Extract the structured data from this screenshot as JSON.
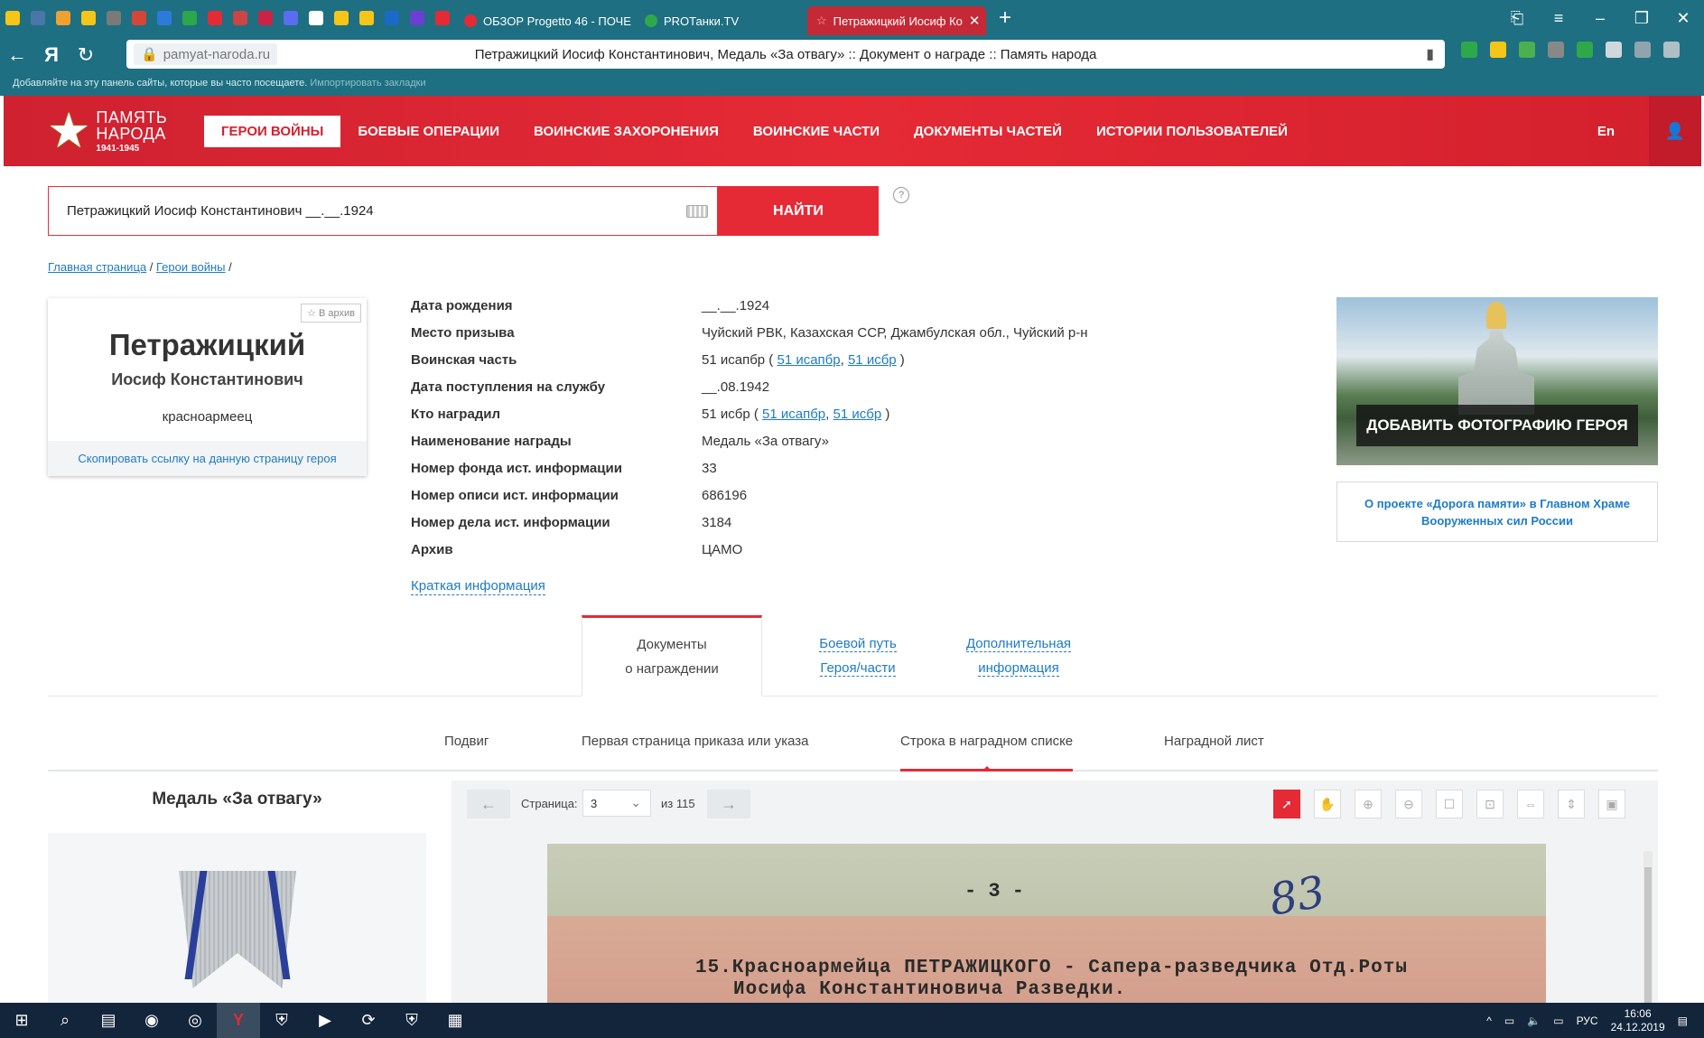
{
  "browser": {
    "favicon_colors": [
      "#f5c518",
      "#4a76a8",
      "#f0a030",
      "#f5c518",
      "#7a7a7a",
      "#d44638",
      "#2d7bd8",
      "#2aa84a",
      "#e52a35",
      "#c44",
      "#c24",
      "#5b6cf0",
      "#ffffff",
      "#f5c518",
      "#f5c518",
      "#1b6ac9",
      "#6b3fd4",
      "#e52a35"
    ],
    "tabs": [
      {
        "label": "ОБЗОР Progetto 46 - ПОЧЕ",
        "color": "#e52a35"
      },
      {
        "label": "PROТанки.TV",
        "color": "#2fa84a"
      },
      {
        "label": "Петражицкий Иосиф Ко",
        "color": "#e52a35",
        "active": true
      }
    ],
    "new_tab": "+",
    "domain": "pamyat-naroda.ru",
    "page_title": "Петражицкий Иосиф Константинович, Медаль «За отвагу» :: Документ о награде :: Память народа",
    "bookmarks_hint": "Добавляйте на эту панель сайты, которые вы часто посещаете.",
    "bookmarks_import": "Импортировать закладки",
    "extension_colors": [
      "#2fa84a",
      "#f5c518",
      "#4caf50",
      "#888888",
      "#2fa84a",
      "#cfd8dc",
      "#90a4ae",
      "#b0bec5"
    ]
  },
  "site": {
    "logo_line1": "ПАМЯТЬ",
    "logo_line2": "НАРОДА",
    "logo_years": "1941-1945",
    "menu": [
      "ГЕРОИ ВОЙНЫ",
      "БОЕВЫЕ ОПЕРАЦИИ",
      "ВОИНСКИЕ ЗАХОРОНЕНИЯ",
      "ВОИНСКИЕ ЧАСТИ",
      "ДОКУМЕНТЫ ЧАСТЕЙ",
      "ИСТОРИИ ПОЛЬЗОВАТЕЛЕЙ"
    ],
    "lang": "En"
  },
  "search": {
    "value": "Петражицкий Иосиф Константинович __.__.1924",
    "button": "НАЙТИ",
    "help": "?"
  },
  "breadcrumbs": {
    "home": "Главная страница",
    "section": "Герои войны",
    "sep": "/"
  },
  "hero": {
    "archive_btn": "В архив",
    "surname": "Петражицкий",
    "given": "Иосиф Константинович",
    "rank": "красноармеец",
    "copy_link": "Скопировать ссылку на данную страницу героя"
  },
  "info": {
    "birth_label": "Дата рождения",
    "birth": "__.__.1924",
    "draft_label": "Место призыва",
    "draft": "Чуйский РВК, Казахская ССР, Джамбулская обл., Чуйский р-н",
    "unit_label": "Воинская часть",
    "unit": "51 исапбр",
    "unit_l1": "51 исапбр",
    "unit_l2": "51 исбр",
    "service_label": "Дата поступления на службу",
    "service": "__.08.1942",
    "awarder_label": "Кто наградил",
    "awarder": "51 исбр",
    "awarder_l1": "51 исапбр",
    "awarder_l2": "51 исбр",
    "award_label": "Наименование награды",
    "award": "Медаль «За отвагу»",
    "fond_label": "Номер фонда ист. информации",
    "fond": "33",
    "opis_label": "Номер описи ист. информации",
    "opis": "686196",
    "delo_label": "Номер дела ист. информации",
    "delo": "3184",
    "archive_label": "Архив",
    "archive": "ЦАМО",
    "brief": "Краткая информация"
  },
  "promo": {
    "button": "ДОБАВИТЬ ФОТОГРАФИЮ ГЕРОЯ",
    "link": "О проекте «Дорога памяти» в Главном Храме Вооруженных сил России"
  },
  "doc_tabs": {
    "t1a": "Документы",
    "t1b": "о награждении",
    "t2a": "Боевой путь",
    "t2b": "Героя/части",
    "t3a": "Дополнительная",
    "t3b": "информация"
  },
  "sub_tabs": [
    "Подвиг",
    "Первая страница приказа или указа",
    "Строка в наградном списке",
    "Наградной лист"
  ],
  "medal_title": "Медаль «За отвагу»",
  "viewer": {
    "prev": "←",
    "next": "→",
    "page_label": "Страница:",
    "page": "3",
    "of": "из 115",
    "doc_page": "- 3 -",
    "doc_hand": "83",
    "doc_line1": "15.Красноармейца ПЕТРАЖИЦКОГО -  Сапера-разведчика Отд.Роты",
    "doc_line2": "Иосифа Константиновича             Разведки."
  },
  "taskbar": {
    "lang": "РУС",
    "time": "16:06",
    "date": "24.12.2019"
  }
}
